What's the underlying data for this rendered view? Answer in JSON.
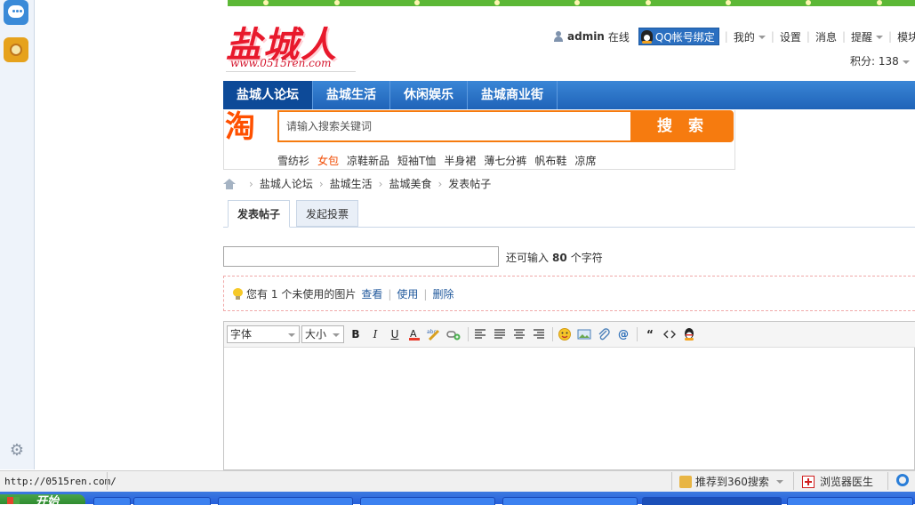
{
  "logo": {
    "title": "盐城人",
    "url": "www.0515ren.com"
  },
  "user": {
    "name": "admin",
    "status": "在线",
    "qq_bind": "QQ帐号绑定",
    "links": [
      "我的",
      "设置",
      "消息",
      "提醒",
      "模块"
    ],
    "score_label": "积分: 138"
  },
  "nav": {
    "items": [
      "盐城人论坛",
      "盐城生活",
      "休闲娱乐",
      "盐城商业街"
    ]
  },
  "taobao": {
    "logo_char": "淘",
    "placeholder": "请输入搜索关键词",
    "button": "搜 索",
    "hotwords": [
      "雪纺衫",
      "女包",
      "凉鞋新品",
      "短袖T恤",
      "半身裙",
      "薄七分裤",
      "帆布鞋",
      "凉席"
    ],
    "hot_index": 1
  },
  "breadcrumb": [
    "盐城人论坛",
    "盐城生活",
    "盐城美食",
    "发表帖子"
  ],
  "tabs": [
    "发表帖子",
    "发起投票"
  ],
  "subject": {
    "value": "",
    "hint_prefix": "还可输入",
    "hint_count": "80",
    "hint_suffix": "个字符"
  },
  "image_notice": {
    "prefix": "您有",
    "count": "1",
    "suffix": "个未使用的图片",
    "actions": [
      "查看",
      "使用",
      "删除"
    ]
  },
  "editor": {
    "font_select": "字体",
    "size_select": "大小",
    "tools": [
      "B",
      "I",
      "U"
    ]
  },
  "statusbar": {
    "url": "http://0515ren.com/",
    "recommend": "推荐到360搜索",
    "doctor": "浏览器医生"
  },
  "taskbar": {
    "start": "开始"
  },
  "colors": {
    "nav_blue": "#1f63b8",
    "taobao_orange": "#f67b0f",
    "logo_red": "#e8192c"
  }
}
